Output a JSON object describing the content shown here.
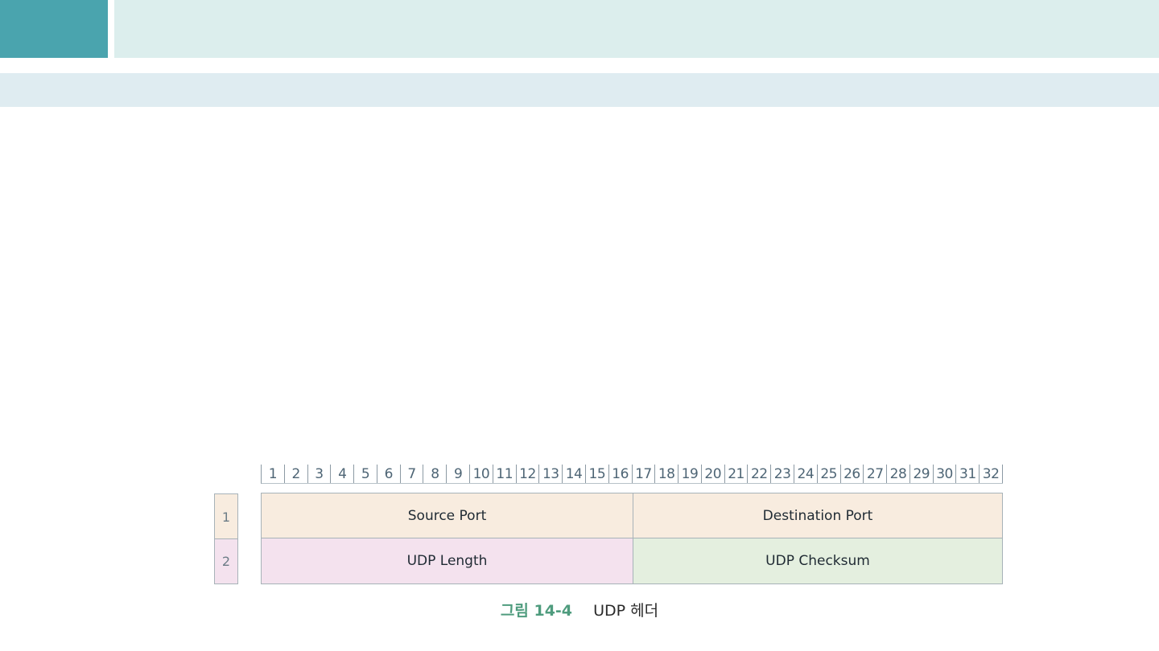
{
  "colors": {
    "header_accent": "#4aa4ae",
    "header_bar": "#dceeed",
    "subheader_bar": "#dfecf1",
    "row1_fill": "#f8ecdf",
    "row2_left_fill": "#f4e2ee",
    "row2_right_fill": "#e4efdf",
    "caption_label": "#4f9c7e"
  },
  "diagram": {
    "bits": [
      "1",
      "2",
      "3",
      "4",
      "5",
      "6",
      "7",
      "8",
      "9",
      "10",
      "11",
      "12",
      "13",
      "14",
      "15",
      "16",
      "17",
      "18",
      "19",
      "20",
      "21",
      "22",
      "23",
      "24",
      "25",
      "26",
      "27",
      "28",
      "29",
      "30",
      "31",
      "32"
    ],
    "rows": [
      {
        "number": "1",
        "fields": [
          "Source Port",
          "Destination Port"
        ]
      },
      {
        "number": "2",
        "fields": [
          "UDP Length",
          "UDP Checksum"
        ]
      }
    ]
  },
  "caption": {
    "label": "그림 14-4",
    "text": "UDP 헤더"
  }
}
